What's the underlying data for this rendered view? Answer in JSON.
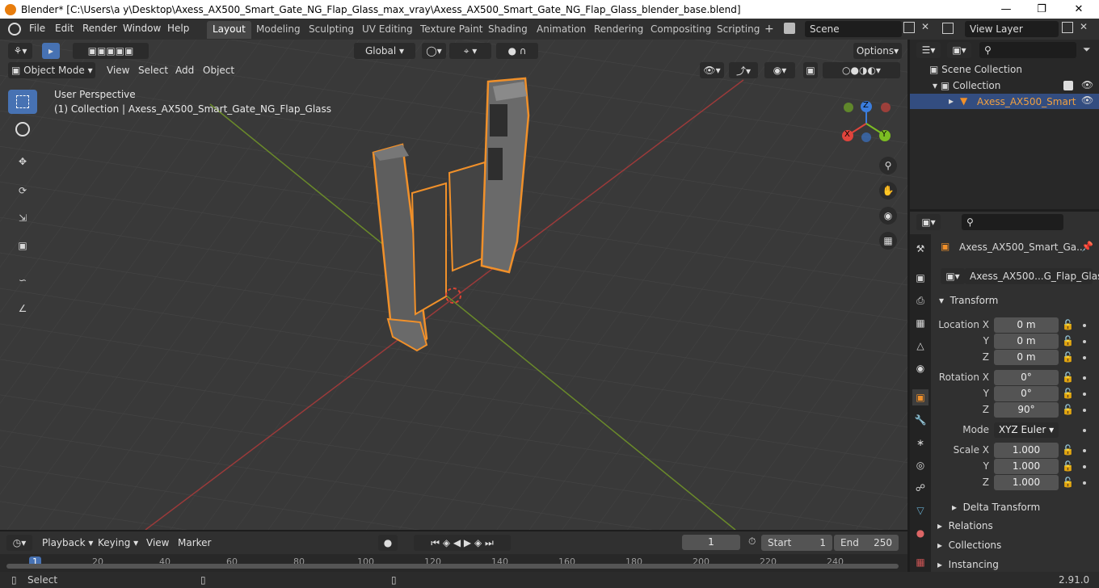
{
  "window": {
    "title": "Blender* [C:\\Users\\a y\\Desktop\\Axess_AX500_Smart_Gate_NG_Flap_Glass_max_vray\\Axess_AX500_Smart_Gate_NG_Flap_Glass_blender_base.blend]"
  },
  "menu": [
    "File",
    "Edit",
    "Render",
    "Window",
    "Help"
  ],
  "workspaces": [
    "Layout",
    "Modeling",
    "Sculpting",
    "UV Editing",
    "Texture Paint",
    "Shading",
    "Animation",
    "Rendering",
    "Compositing",
    "Scripting"
  ],
  "scene": {
    "name": "Scene",
    "view_layer": "View Layer"
  },
  "viewport": {
    "mode": "Object Mode",
    "menus": [
      "View",
      "Select",
      "Add",
      "Object"
    ],
    "orientation": "Global",
    "options": "Options",
    "overlay_title": "User Perspective",
    "overlay_sub": "(1) Collection | Axess_AX500_Smart_Gate_NG_Flap_Glass"
  },
  "gizmo": {
    "x": "X",
    "y": "Y",
    "z": "Z"
  },
  "outliner": {
    "scene_collection": "Scene Collection",
    "collection": "Collection",
    "object": "Axess_AX500_Smart"
  },
  "properties": {
    "object_name": "Axess_AX500_Smart_Ga...",
    "data_name": "Axess_AX500...G_Flap_Glass",
    "transform": "Transform",
    "location": {
      "label": "Location X",
      "x": "0 m",
      "y": "0 m",
      "z": "0 m"
    },
    "rotation": {
      "label": "Rotation X",
      "x": "0°",
      "y": "0°",
      "z": "90°"
    },
    "mode_label": "Mode",
    "mode": "XYZ Euler",
    "scale": {
      "label": "Scale X",
      "x": "1.000",
      "y": "1.000",
      "z": "1.000"
    },
    "axis_y": "Y",
    "axis_z": "Z",
    "sections": [
      "Delta Transform",
      "Relations",
      "Collections",
      "Instancing"
    ]
  },
  "timeline": {
    "menus": [
      "Playback",
      "Keying",
      "View",
      "Marker"
    ],
    "current": "1",
    "start_label": "Start",
    "start": "1",
    "end_label": "End",
    "end": "250",
    "ticks": [
      "1",
      "20",
      "40",
      "60",
      "80",
      "100",
      "120",
      "140",
      "160",
      "180",
      "200",
      "220",
      "240"
    ]
  },
  "status": {
    "left": "Select",
    "version": "2.91.0"
  }
}
